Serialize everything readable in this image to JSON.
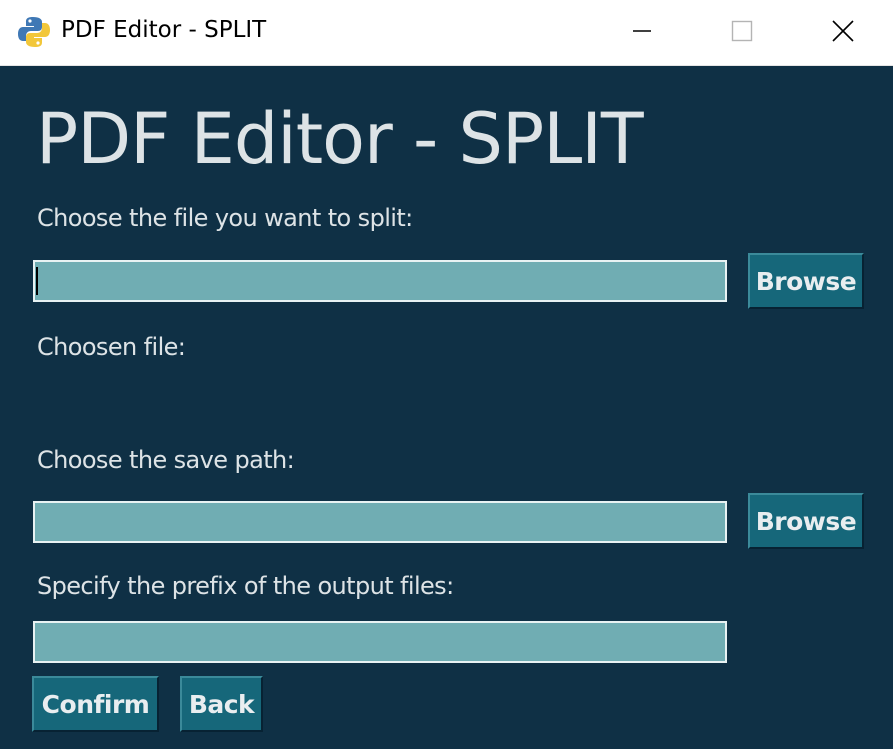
{
  "window": {
    "title": "PDF Editor - SPLIT",
    "controls": {
      "minimize": "minimize-icon",
      "maximize": "maximize-icon",
      "close": "close-icon"
    }
  },
  "main": {
    "heading": "PDF Editor - SPLIT",
    "file": {
      "label": "Choose the file you want to split:",
      "value": "",
      "browse_label": "Browse"
    },
    "chosen_file": {
      "label": "Choosen file:"
    },
    "save_path": {
      "label": "Choose the save path:",
      "value": "",
      "browse_label": "Browse"
    },
    "prefix": {
      "label": "Specify the prefix of the output files:",
      "value": ""
    },
    "actions": {
      "confirm_label": "Confirm",
      "back_label": "Back"
    }
  },
  "colors": {
    "background": "#0f3045",
    "field": "#70adb3",
    "button": "#16677a",
    "text": "#dde3e6"
  }
}
